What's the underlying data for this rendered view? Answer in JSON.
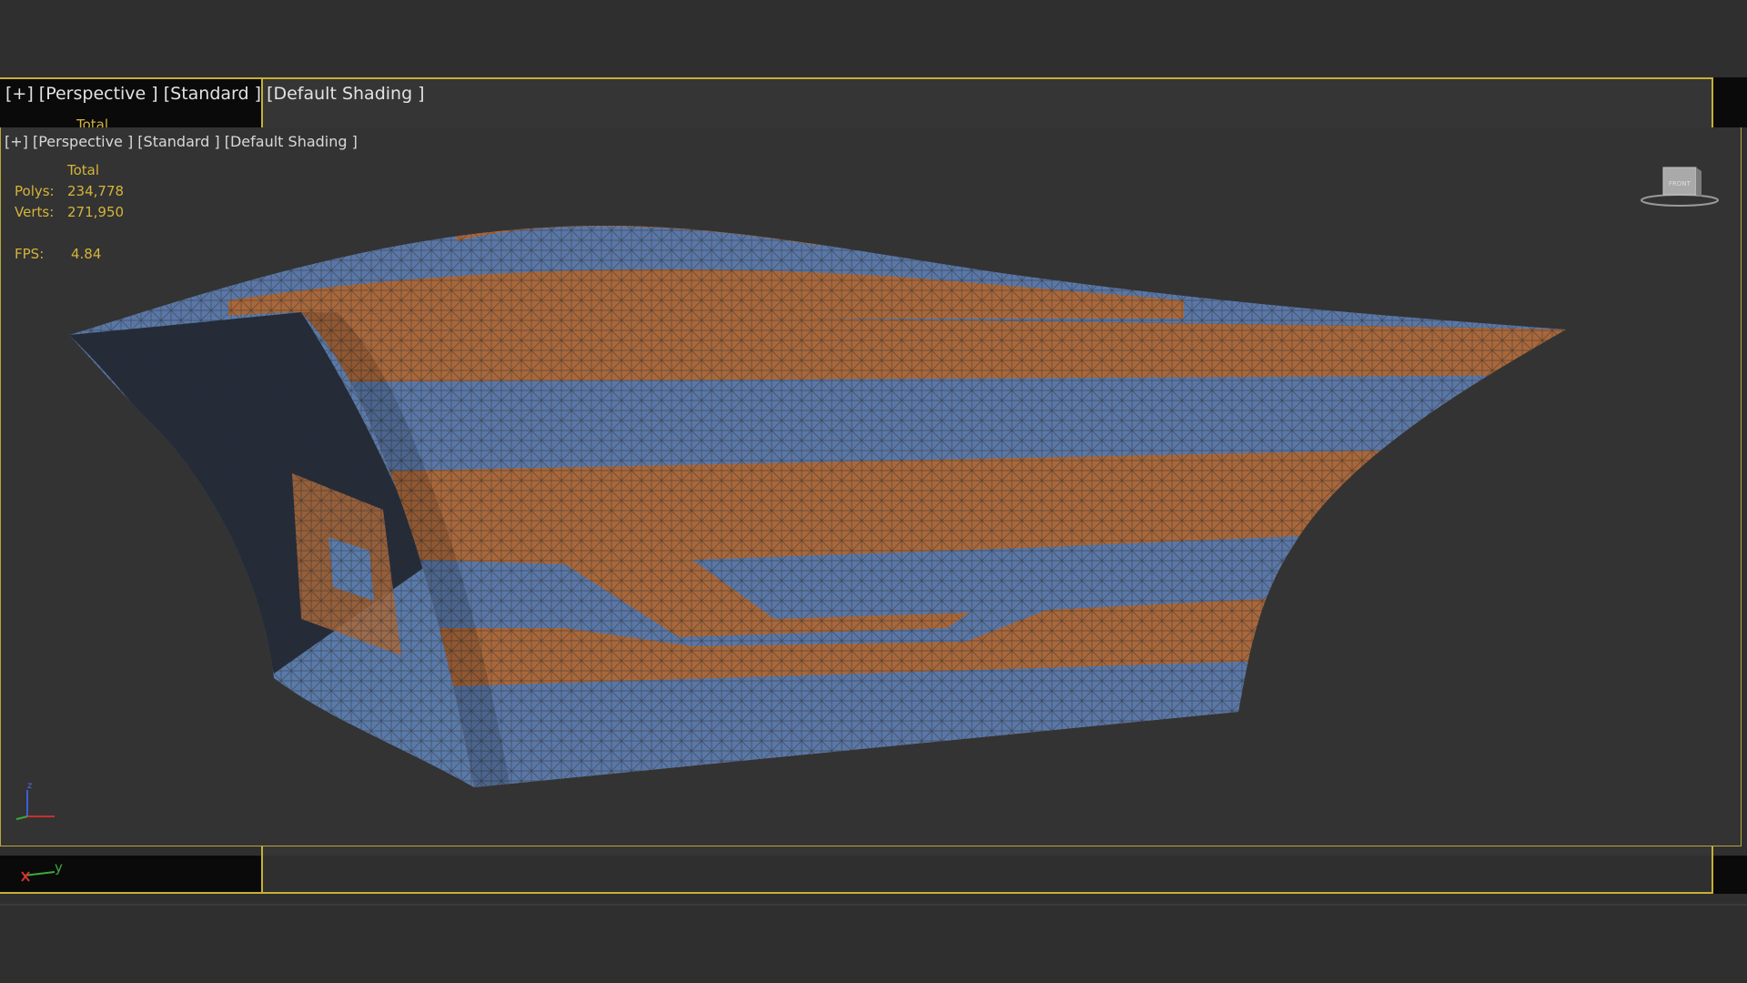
{
  "outer_viewport": {
    "label": "[+] [Perspective ] [Standard ] [Default Shading ]",
    "ghost_total": "Total"
  },
  "viewport": {
    "label": "[+] [Perspective ] [Standard ] [Default Shading ]",
    "stats": {
      "header": "Total",
      "polys_label": "Polys:",
      "polys_value": "234,778",
      "verts_label": "Verts:",
      "verts_value": "271,950",
      "fps_label": "FPS:",
      "fps_value": "4.84"
    },
    "viewcube_label": "FRONT"
  },
  "axis_gizmo": {
    "x": "x",
    "y": "y",
    "z": "z"
  },
  "colors": {
    "background": "#2f2f2f",
    "viewport_bg": "#333333",
    "frame_border": "#c8b034",
    "stats_text": "#d4b43a",
    "mesh_orange": "#a8683c",
    "mesh_blue": "#5a77a6"
  }
}
